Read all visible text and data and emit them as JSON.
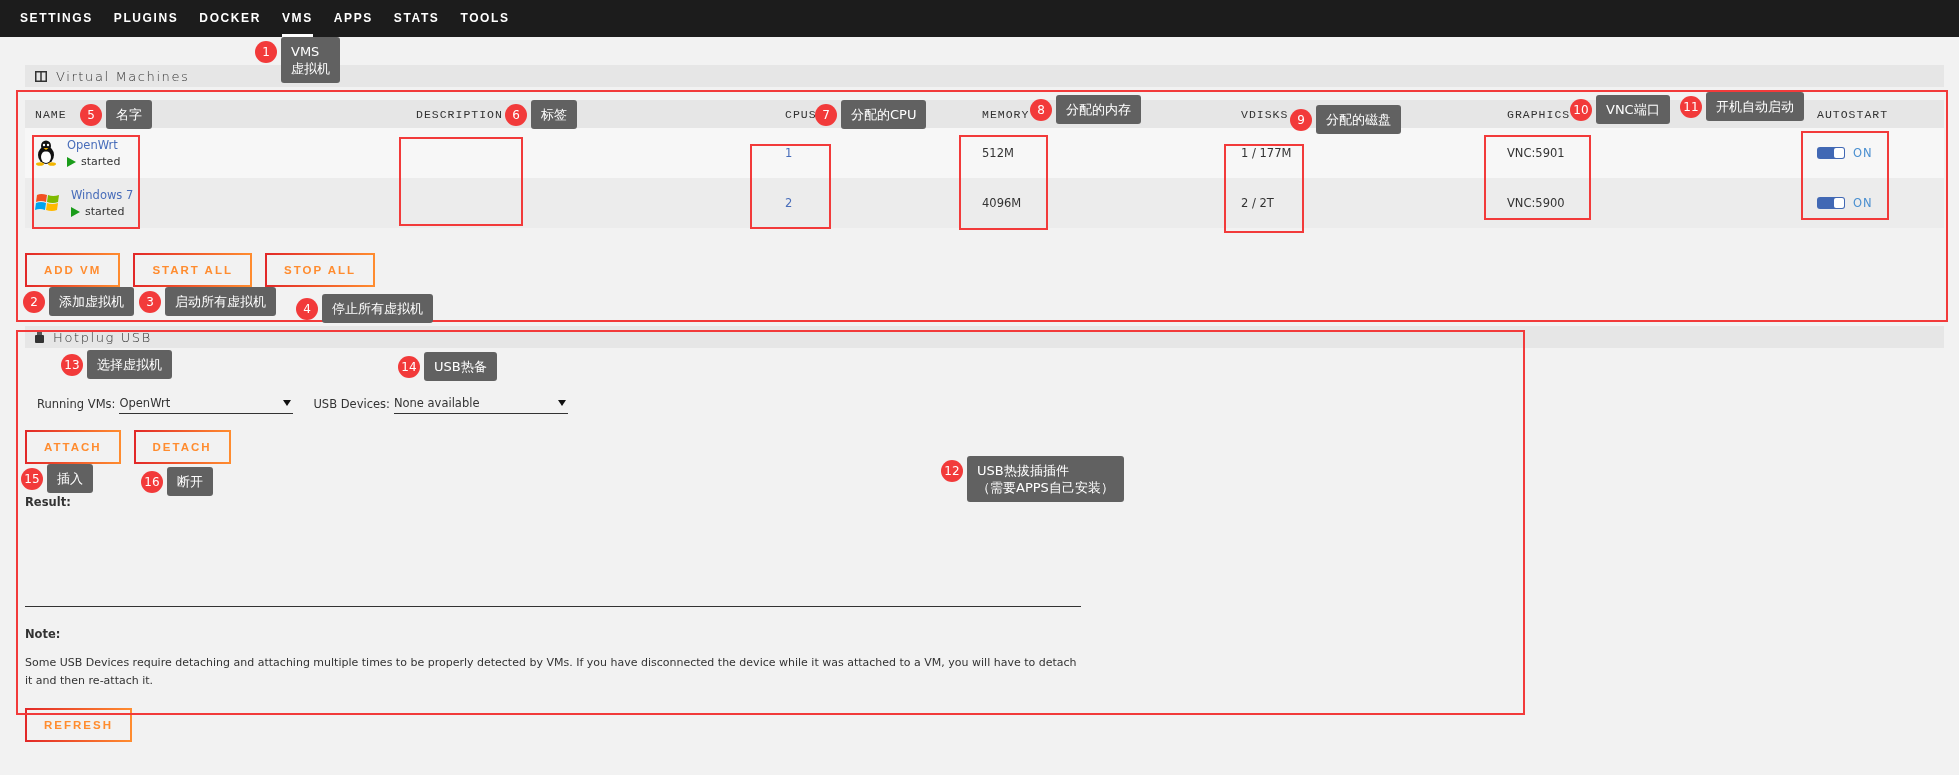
{
  "nav": [
    {
      "label": "SETTINGS",
      "selected": false
    },
    {
      "label": "PLUGINS",
      "selected": false
    },
    {
      "label": "DOCKER",
      "selected": false
    },
    {
      "label": "VMS",
      "selected": true
    },
    {
      "label": "APPS",
      "selected": false
    },
    {
      "label": "STATS",
      "selected": false
    },
    {
      "label": "TOOLS",
      "selected": false
    }
  ],
  "vm_section": {
    "title": "Virtual Machines",
    "columns": [
      "NAME",
      "DESCRIPTION",
      "CPUS",
      "MEMORY",
      "VDISKS",
      "GRAPHICS",
      "AUTOSTART"
    ],
    "rows": [
      {
        "kind": "linux",
        "name": "OpenWrt",
        "running": true,
        "status": "started",
        "cpus": "1",
        "memory": "512M",
        "vdisks": "1 / 177M",
        "graphics": "VNC:5901",
        "autostart": true,
        "autostart_label": "ON"
      },
      {
        "kind": "windows",
        "name": "Windows 7",
        "running": true,
        "status": "started",
        "cpus": "2",
        "memory": "4096M",
        "vdisks": "2 / 2T",
        "graphics": "VNC:5900",
        "autostart": true,
        "autostart_label": "ON"
      }
    ],
    "buttons": [
      "ADD VM",
      "START ALL",
      "STOP ALL"
    ]
  },
  "usb_section": {
    "title": "Hotplug USB",
    "running_vms": {
      "label": "Running VMs:",
      "value": "OpenWrt"
    },
    "usb_devices": {
      "label": "USB Devices:",
      "value": "None available"
    },
    "buttons": [
      "ATTACH",
      "DETACH"
    ],
    "result_label": "Result:",
    "note_label": "Note:",
    "note_text": "Some USB Devices require detaching and attaching multiple times to be properly detected by VMs.  If you have disconnected the device while it was attached to a VM, you will have to detach it and then re-attach it."
  },
  "refresh_button": "REFRESH",
  "annotations": [
    {
      "number": "1",
      "lines": [
        "VMS",
        "虚拟机"
      ]
    },
    {
      "number": "2",
      "text": "添加虚拟机"
    },
    {
      "number": "3",
      "text": "启动所有虚拟机"
    },
    {
      "number": "4",
      "text": "停止所有虚拟机"
    },
    {
      "number": "5",
      "text": "名字"
    },
    {
      "number": "6",
      "text": "标签"
    },
    {
      "number": "7",
      "text": "分配的CPU"
    },
    {
      "number": "8",
      "text": "分配的内存"
    },
    {
      "number": "9",
      "text": "分配的磁盘"
    },
    {
      "number": "10",
      "text": "VNC端口"
    },
    {
      "number": "11",
      "text": "开机自动启动"
    },
    {
      "number": "12",
      "lines": [
        "USB热拔插插件",
        "（需要APPS自己安装）"
      ]
    },
    {
      "number": "13",
      "text": "选择虚拟机"
    },
    {
      "number": "14",
      "text": "USB热备"
    },
    {
      "number": "15",
      "text": "插入"
    },
    {
      "number": "16",
      "text": "断开"
    }
  ]
}
